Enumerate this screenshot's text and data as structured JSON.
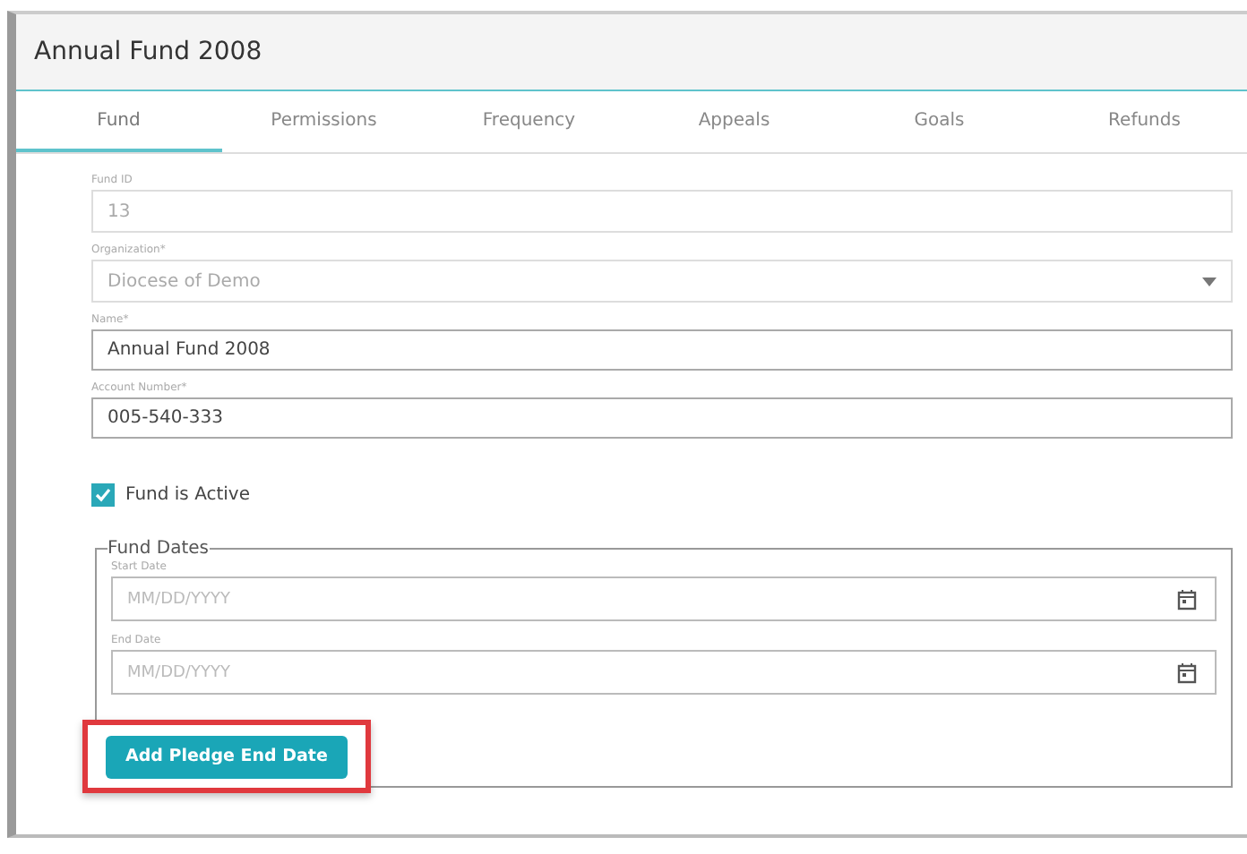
{
  "window": {
    "title": "Annual Fund 2008"
  },
  "tabs": [
    {
      "label": "Fund",
      "selected": true
    },
    {
      "label": "Permissions",
      "selected": false
    },
    {
      "label": "Frequency",
      "selected": false
    },
    {
      "label": "Appeals",
      "selected": false
    },
    {
      "label": "Goals",
      "selected": false
    },
    {
      "label": "Refunds",
      "selected": false
    }
  ],
  "fields": [
    {
      "kind": "text",
      "label": "Fund ID",
      "value": "13",
      "disabled": true
    },
    {
      "kind": "select",
      "label": "Organization*",
      "value": "Diocese of Demo",
      "disabled": true
    },
    {
      "kind": "text",
      "label": "Name*",
      "value": "Annual Fund 2008",
      "disabled": false
    },
    {
      "kind": "text",
      "label": "Account Number*",
      "value": "005-540-333",
      "disabled": false
    }
  ],
  "active_checkbox": {
    "label": "Fund is Active",
    "checked": true
  },
  "fund_dates": {
    "legend": "Fund Dates",
    "fields": [
      {
        "label": "Start Date",
        "placeholder": "MM/DD/YYYY"
      },
      {
        "label": "End Date",
        "placeholder": "MM/DD/YYYY"
      }
    ],
    "button": "Add Pledge End Date",
    "highlighted": true
  }
}
